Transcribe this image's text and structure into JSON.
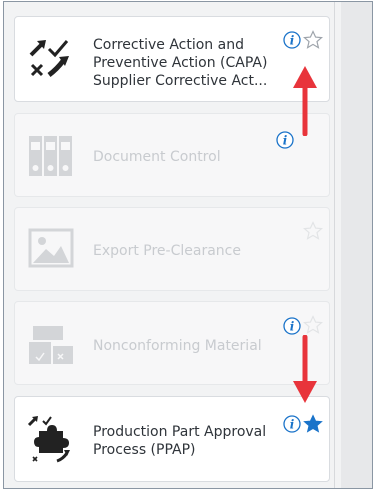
{
  "apps": [
    {
      "label": "Corrective Action and Preventive Action (CAPA) Supplier Corrective Act...",
      "icon": "capa-arrows-icon",
      "enabled": true,
      "favorite": false
    },
    {
      "label": "Document Control",
      "icon": "binders-icon",
      "enabled": false,
      "favorite": false
    },
    {
      "label": "Export Pre-Clearance",
      "icon": "image-placeholder-icon",
      "enabled": false,
      "favorite": false
    },
    {
      "label": "Nonconforming Material",
      "icon": "boxes-icon",
      "enabled": false,
      "favorite": false
    },
    {
      "label": "Production Part Approval Process (PPAP)",
      "icon": "puzzle-icon",
      "enabled": true,
      "favorite": true
    }
  ],
  "colors": {
    "info_blue": "#1a73c9",
    "star_filled": "#1a73c9",
    "star_outline": "#b9bec4",
    "annotation_arrow": "#e8343b"
  }
}
